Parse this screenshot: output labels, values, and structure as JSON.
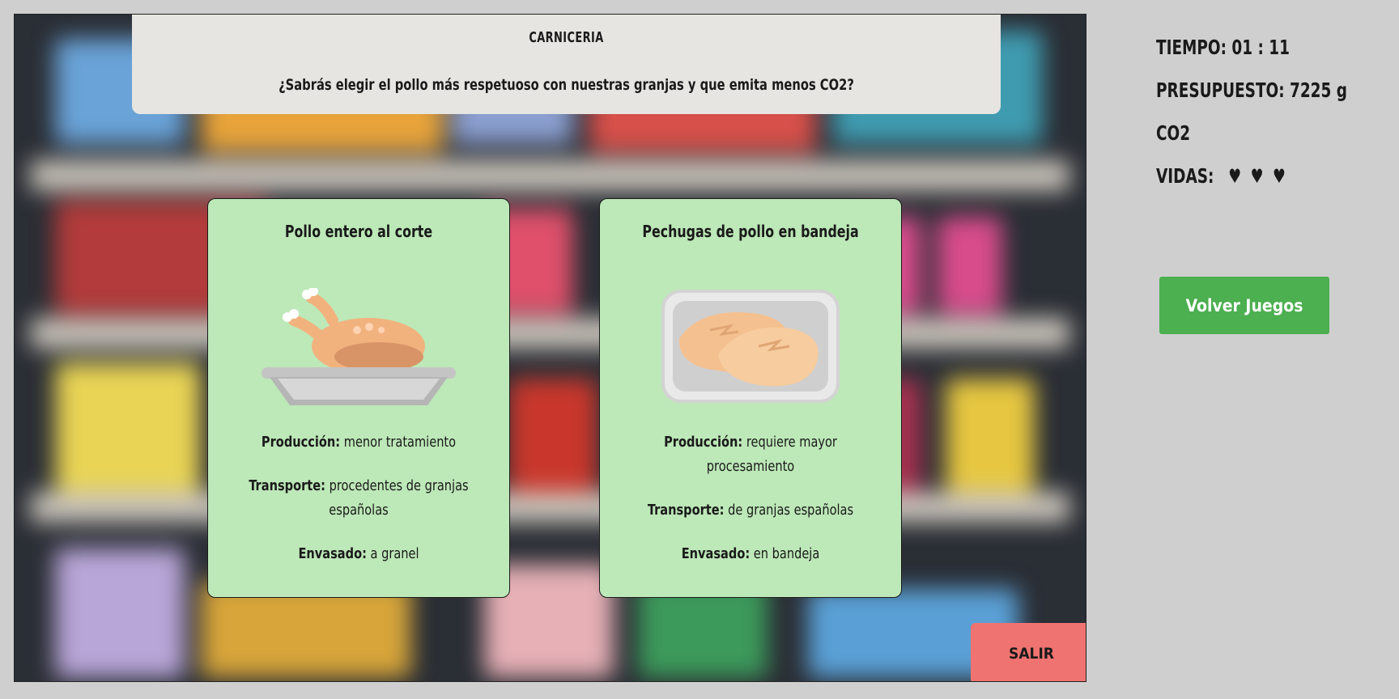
{
  "game": {
    "section_title": "CARNICERIA",
    "question": "¿Sabrás elegir el pollo más respetuoso con nuestras granjas y que emita menos CO2?"
  },
  "options": [
    {
      "title": "Pollo entero al corte",
      "image": "whole-roast-chicken-on-tray",
      "production_label": "Producción:",
      "production_value": "menor tratamiento",
      "transport_label": "Transporte:",
      "transport_value": "procedentes de granjas españolas",
      "packaging_label": "Envasado:",
      "packaging_value": "a granel"
    },
    {
      "title": "Pechugas de pollo en bandeja",
      "image": "chicken-breasts-in-plastic-tray",
      "production_label": "Producción:",
      "production_value": "requiere mayor procesamiento",
      "transport_label": "Transporte:",
      "transport_value": "de granjas españolas",
      "packaging_label": "Envasado:",
      "packaging_value": "en bandeja"
    }
  ],
  "hud": {
    "time_label": "TIEMPO:",
    "time_value": "01 : 11",
    "budget_label": "PRESUPUESTO:",
    "budget_value": "7225 g CO2",
    "lives_label": "VIDAS:",
    "lives": 3,
    "heart_glyph": "♥"
  },
  "buttons": {
    "back": "Volver Juegos",
    "exit": "SALIR"
  },
  "colors": {
    "card_bg": "#bde8b8",
    "back_button": "#4caf50",
    "exit_button": "#ef7370",
    "panel_bg": "#e6e5e1",
    "page_bg": "#cfcfcf"
  }
}
